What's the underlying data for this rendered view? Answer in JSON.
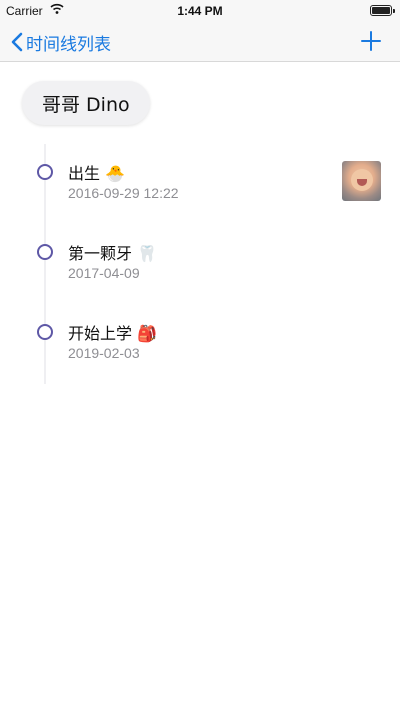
{
  "status_bar": {
    "carrier": "Carrier",
    "time": "1:44 PM"
  },
  "nav": {
    "back_label": "时间线列表",
    "accent_color": "#1a7ae0"
  },
  "person": {
    "name": "哥哥 Dino"
  },
  "events": [
    {
      "title": "出生 🐣",
      "date": "2016-09-29 12:22",
      "has_photo": true
    },
    {
      "title": "第一颗牙 🦷",
      "date": "2017-04-09",
      "has_photo": false
    },
    {
      "title": "开始上学 🎒",
      "date": "2019-02-03",
      "has_photo": false
    }
  ],
  "colors": {
    "timeline_dot": "#5e58a6",
    "timeline_line": "#efeff2",
    "date_text": "#8e8e93"
  }
}
